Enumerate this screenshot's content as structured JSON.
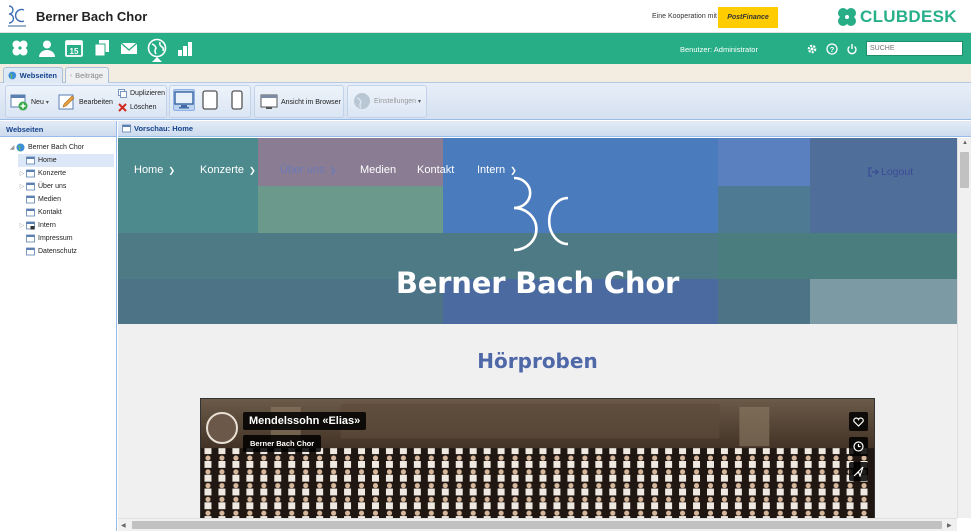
{
  "header": {
    "org_name": "Berner Bach Chor",
    "cooperation_text": "Eine Kooperation mit",
    "partner_logo_text": "PostFinance",
    "brand_name": "CLUBDESK",
    "brand_color": "#27ae86"
  },
  "topnav": {
    "user_label": "Benutzer: Administrator",
    "search_placeholder": "SUCHE",
    "icons": [
      "clover-icon",
      "user-icon",
      "calendar-icon",
      "documents-icon",
      "mail-icon",
      "website-globe-icon",
      "finance-icon"
    ],
    "calendar_day": "15"
  },
  "tabs": [
    {
      "label": "Webseiten",
      "active": true
    },
    {
      "label": "Beiträge",
      "active": false
    }
  ],
  "toolbar": {
    "new_label": "Neu",
    "edit_label": "Bearbeiten",
    "duplicate_label": "Duplizieren",
    "delete_label": "Löschen",
    "view_browser_label": "Ansicht im Browser",
    "settings_label": "Einstellungen"
  },
  "tree": {
    "title": "Webseiten",
    "root": "Berner Bach Chor",
    "items": [
      {
        "label": "Home",
        "expandable": false,
        "selected": true
      },
      {
        "label": "Konzerte",
        "expandable": true
      },
      {
        "label": "Über uns",
        "expandable": true
      },
      {
        "label": "Medien",
        "expandable": false
      },
      {
        "label": "Kontakt",
        "expandable": false
      },
      {
        "label": "Intern",
        "expandable": true
      },
      {
        "label": "Impressum",
        "expandable": false
      },
      {
        "label": "Datenschutz",
        "expandable": false
      }
    ]
  },
  "preview": {
    "title": "Vorschau: Home",
    "site_nav": [
      {
        "label": "Home",
        "dropdown": true
      },
      {
        "label": "Konzerte",
        "dropdown": true
      },
      {
        "label": "Über uns",
        "dropdown": true
      },
      {
        "label": "Medien",
        "dropdown": false
      },
      {
        "label": "Kontakt",
        "dropdown": false
      },
      {
        "label": "Intern",
        "dropdown": true
      }
    ],
    "logout_label": "Logout",
    "hero_title": "Berner Bach Chor",
    "section_title": "Hörproben",
    "video": {
      "title": "Mendelssohn «Elias»",
      "channel": "Berner Bach Chor"
    }
  }
}
